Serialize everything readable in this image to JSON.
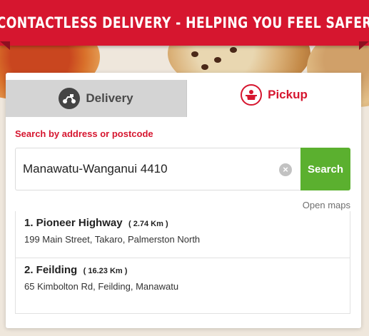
{
  "banner": {
    "text": "CONTACTLESS DELIVERY - HELPING YOU FEEL SAFER"
  },
  "tabs": [
    {
      "label": "Delivery",
      "icon": "scooter-icon",
      "active": false
    },
    {
      "label": "Pickup",
      "icon": "pickup-box-icon",
      "active": true
    }
  ],
  "search": {
    "label": "Search by address or postcode",
    "value": "Manawatu-Wanganui 4410",
    "placeholder": "",
    "button_label": "Search",
    "open_maps": "Open maps"
  },
  "results": [
    {
      "title": "1. Pioneer Highway",
      "distance": "( 2.74 Km )",
      "address": "199 Main Street, Takaro, Palmerston North"
    },
    {
      "title": "2. Feilding",
      "distance": "( 16.23 Km )",
      "address": "65 Kimbolton Rd, Feilding, Manawatu"
    }
  ],
  "colors": {
    "brand_red": "#d6162f",
    "search_green": "#5bb02f",
    "tab_inactive": "#d4d4d4"
  }
}
